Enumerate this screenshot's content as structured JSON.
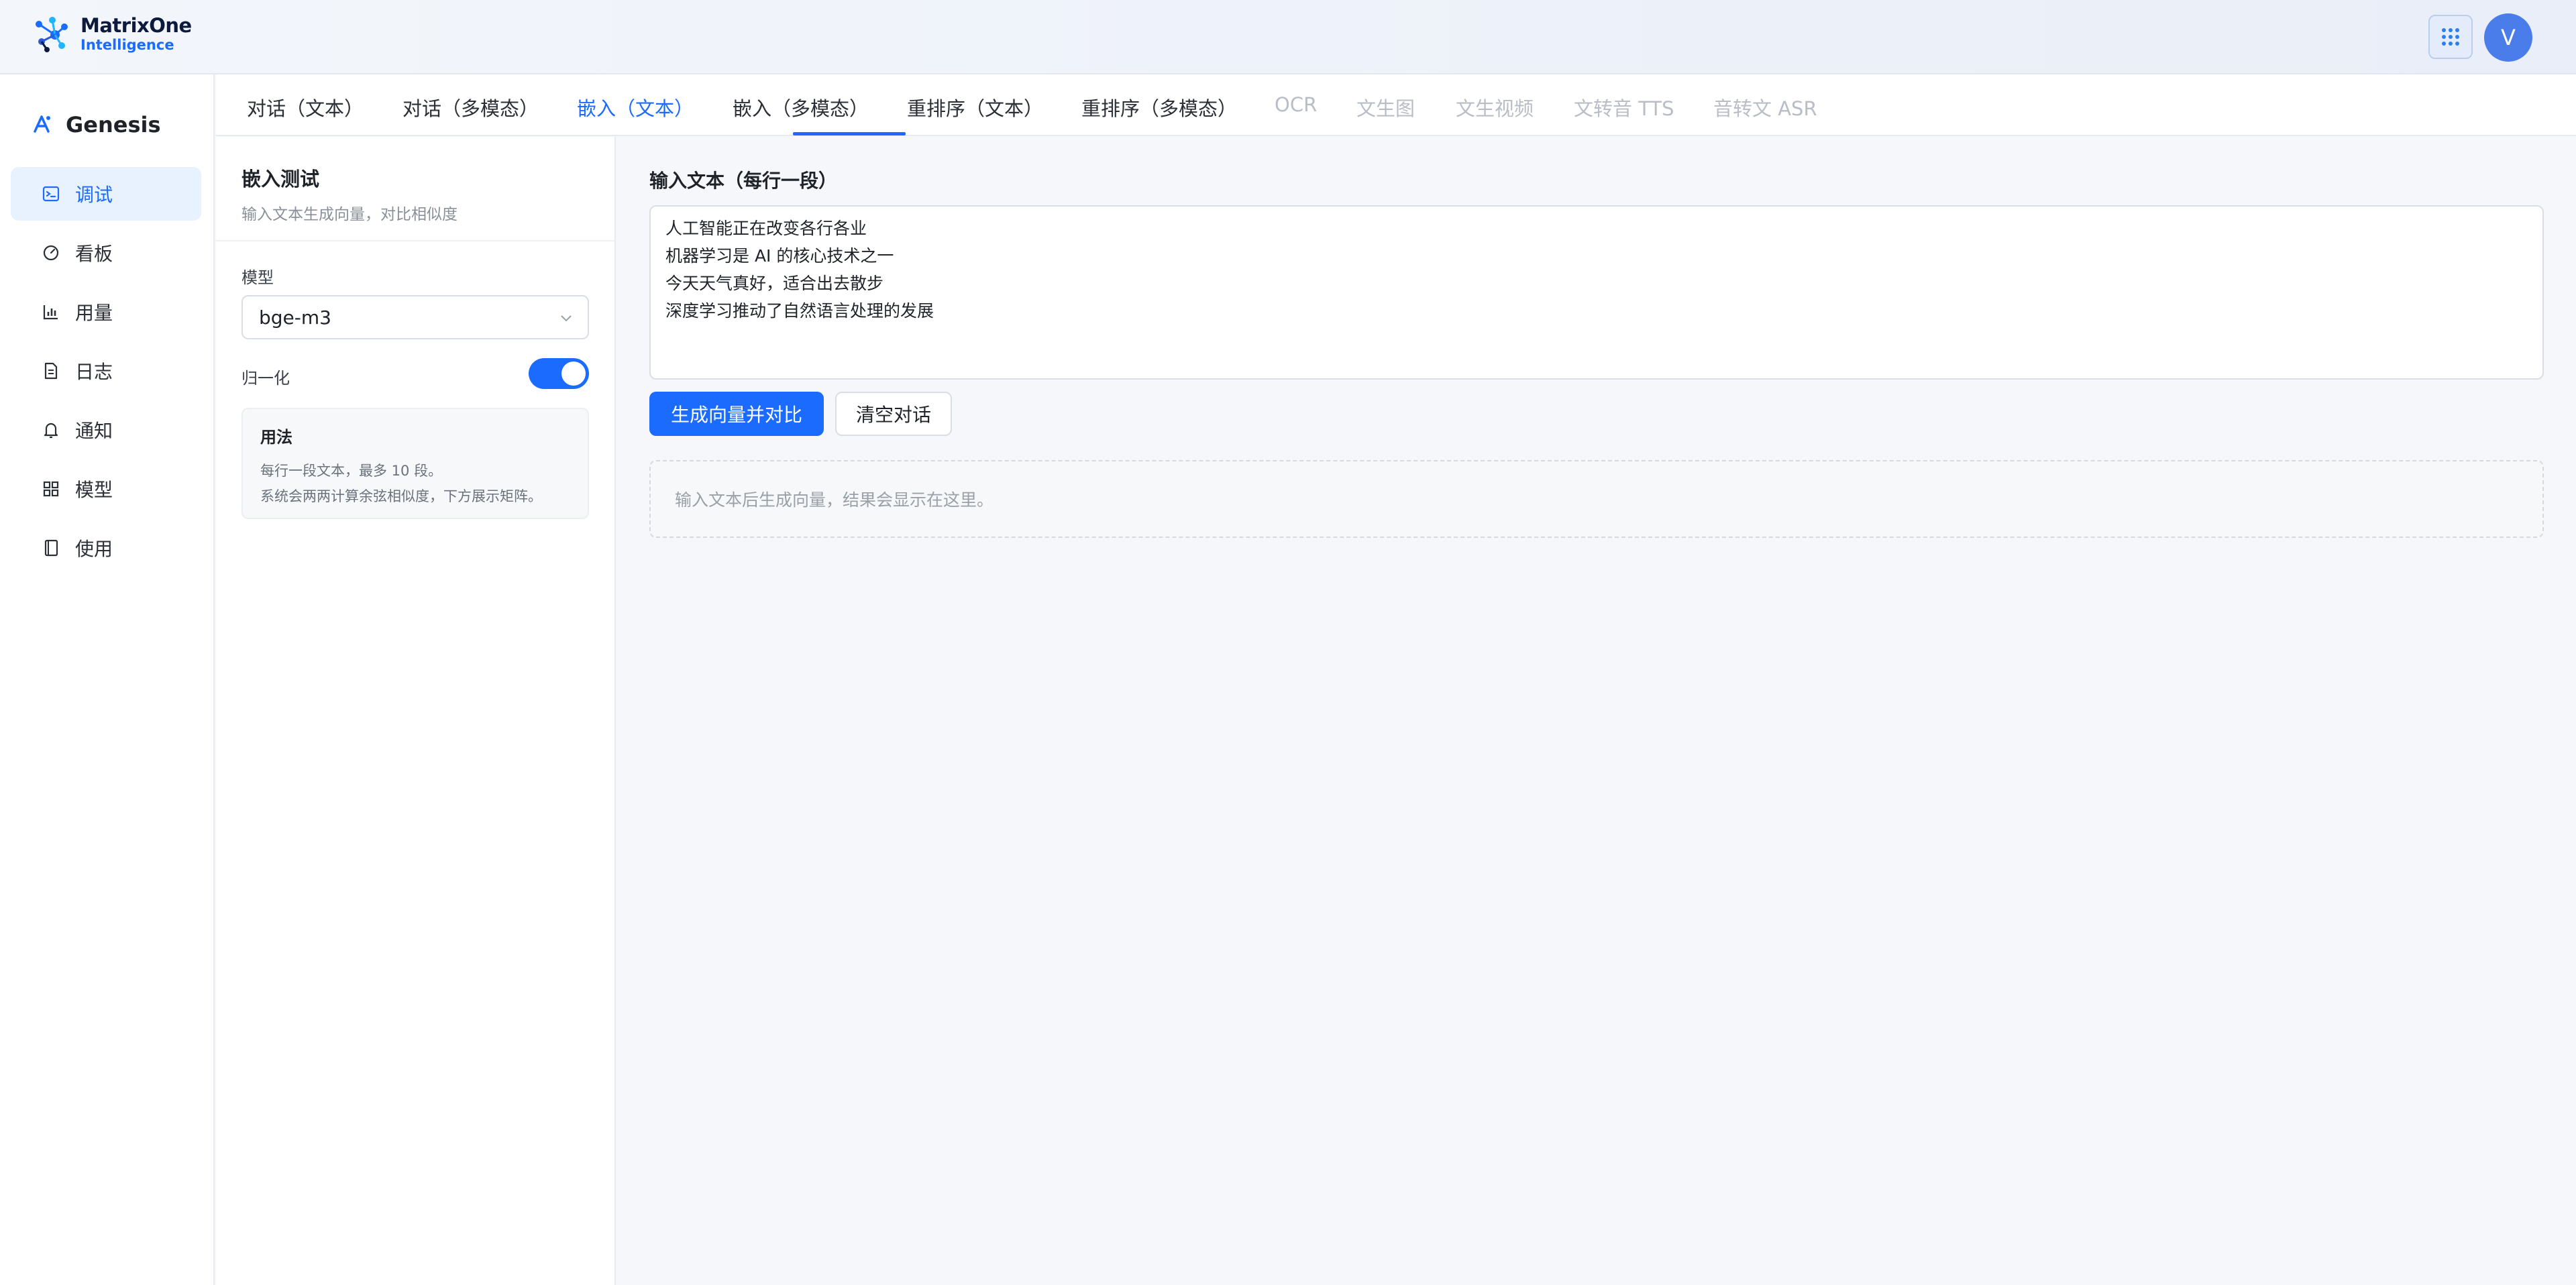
{
  "header": {
    "logo_line1": "MatrixOne",
    "logo_line2": "Intelligence",
    "avatar_initial": "V"
  },
  "sidebar": {
    "brand": "Genesis",
    "items": [
      {
        "label": "调试",
        "icon": "terminal-icon",
        "active": true
      },
      {
        "label": "看板",
        "icon": "gauge-icon"
      },
      {
        "label": "用量",
        "icon": "bar-chart-icon"
      },
      {
        "label": "日志",
        "icon": "file-text-icon"
      },
      {
        "label": "通知",
        "icon": "bell-icon"
      },
      {
        "label": "模型",
        "icon": "grid-icon"
      },
      {
        "label": "使用",
        "icon": "book-icon"
      }
    ]
  },
  "tabs": [
    {
      "label": "对话（文本）"
    },
    {
      "label": "对话（多模态）"
    },
    {
      "label": "嵌入（文本）",
      "active": true
    },
    {
      "label": "嵌入（多模态）"
    },
    {
      "label": "重排序（文本）"
    },
    {
      "label": "重排序（多模态）"
    },
    {
      "label": "OCR",
      "disabled": true
    },
    {
      "label": "文生图",
      "disabled": true
    },
    {
      "label": "文生视频",
      "disabled": true
    },
    {
      "label": "文转音 TTS",
      "disabled": true
    },
    {
      "label": "音转文 ASR",
      "disabled": true
    }
  ],
  "config": {
    "title": "嵌入测试",
    "subtitle": "输入文本生成向量，对比相似度",
    "model_label": "模型",
    "model_value": "bge-m3",
    "normalize_label": "归一化",
    "normalize_on": true,
    "usage_title": "用法",
    "usage_lines": [
      "每行一段文本，最多 10 段。",
      "系统会两两计算余弦相似度，下方展示矩阵。"
    ]
  },
  "main": {
    "input_label": "输入文本（每行一段）",
    "input_lines": [
      "人工智能正在改变各行各业",
      "机器学习是 AI 的核心技术之一",
      "今天天气真好，适合出去散步",
      "深度学习推动了自然语言处理的发展"
    ],
    "generate_button": "生成向量并对比",
    "clear_button": "清空对话",
    "result_placeholder": "输入文本后生成向量，结果会显示在这里。"
  },
  "colors": {
    "accent": "#1b6bff",
    "active_bg": "#e8f1fe",
    "disabled_text": "#b8bdc6"
  }
}
